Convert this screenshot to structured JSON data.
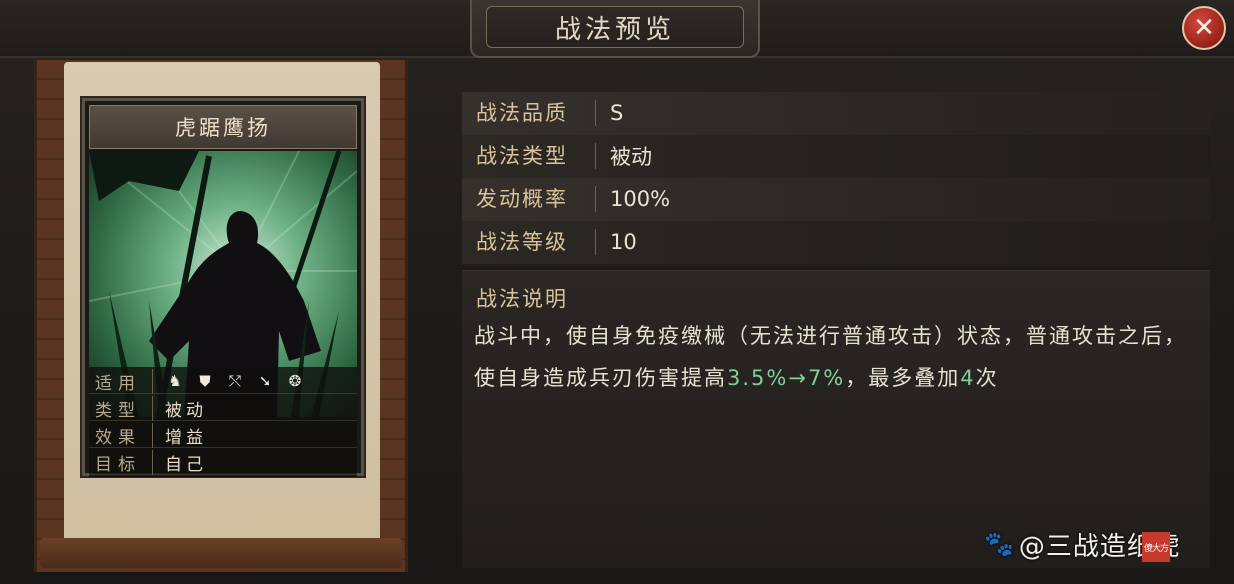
{
  "header": {
    "title": "战法预览",
    "close_glyph": "✕"
  },
  "card": {
    "name": "虎踞鹰扬",
    "stats": [
      {
        "label": "适用",
        "value": ""
      },
      {
        "label": "类型",
        "value": "被动"
      },
      {
        "label": "效果",
        "value": "增益"
      },
      {
        "label": "目标",
        "value": "自己"
      }
    ],
    "troop_icons": [
      "cavalry-icon",
      "shield-icon",
      "bow-icon",
      "spear-icon",
      "vehicle-icon"
    ]
  },
  "info": {
    "rows": [
      {
        "label": "战法品质",
        "value": "S"
      },
      {
        "label": "战法类型",
        "value": "被动"
      },
      {
        "label": "发动概率",
        "value": "100%"
      },
      {
        "label": "战法等级",
        "value": "10"
      }
    ]
  },
  "description": {
    "label": "战法说明",
    "text_before": "战斗中，使自身免疫缴械（无法进行普通攻击）状态，普通攻击之后，使自身造成兵刃伤害提高",
    "highlight_range": "3.5%→7%",
    "text_middle": "，最多叠加",
    "highlight_count": "4",
    "text_after": "次"
  },
  "watermark": {
    "text": "@三战造纸虎",
    "stamp": "傻大方"
  },
  "colors": {
    "highlight": "#7fcf9b",
    "label_gold": "#d9c39a",
    "close_red": "#a1251e"
  }
}
